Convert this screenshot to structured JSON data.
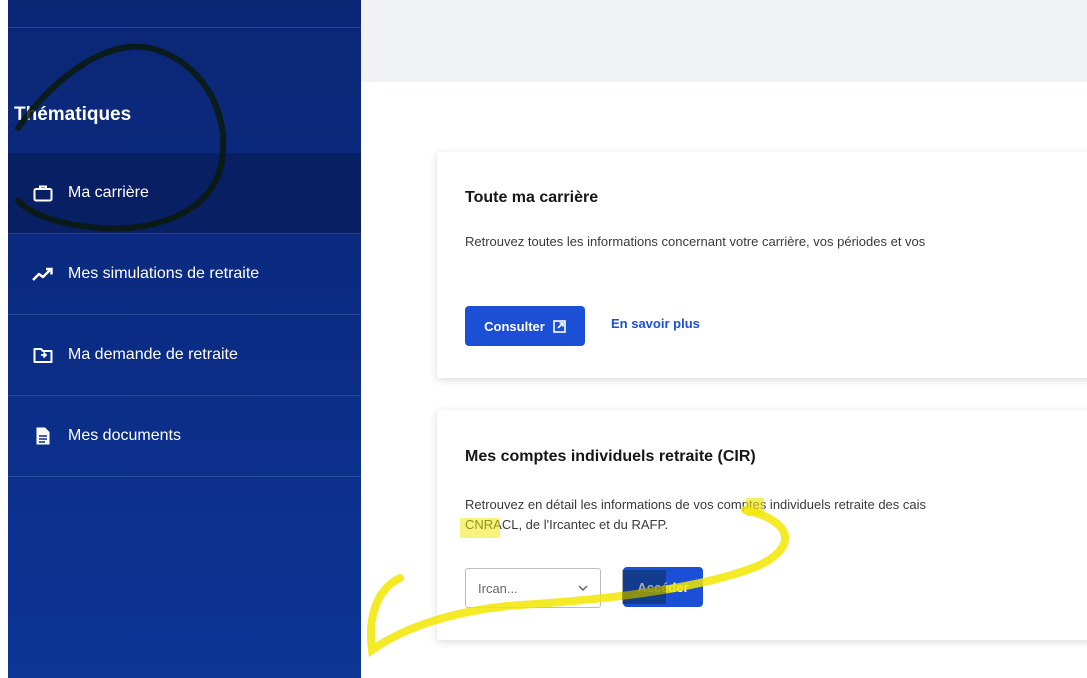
{
  "sidebar": {
    "heading": "Thématiques",
    "items": [
      {
        "label": "Ma carrière",
        "icon": "briefcase-icon",
        "active": true
      },
      {
        "label": "Mes simulations de retraite",
        "icon": "trending-up-icon",
        "active": false
      },
      {
        "label": "Ma demande de retraite",
        "icon": "folder-icon",
        "active": false
      },
      {
        "label": "Mes documents",
        "icon": "document-icon",
        "active": false
      }
    ]
  },
  "cards": [
    {
      "title": "Toute ma carrière",
      "description": "Retrouvez toutes les informations concernant votre carrière, vos périodes et vos",
      "button_label": "Consulter",
      "link_label": "En savoir plus"
    },
    {
      "title": "Mes comptes individuels retraite (CIR)",
      "description_line1": "Retrouvez en détail les informations de vos comptes individuels retraite des cais",
      "description_line2": "CNRACL, de l'Ircantec et du RAFP.",
      "select_value": "Ircan...",
      "button_label": "Accéder"
    }
  ],
  "colors": {
    "sidebar_bg": "#0b2d86",
    "sidebar_active": "#091f63",
    "primary": "#1a4fd6",
    "annotation_highlight": "#f2e600",
    "annotation_dark": "#0a1a0a"
  }
}
